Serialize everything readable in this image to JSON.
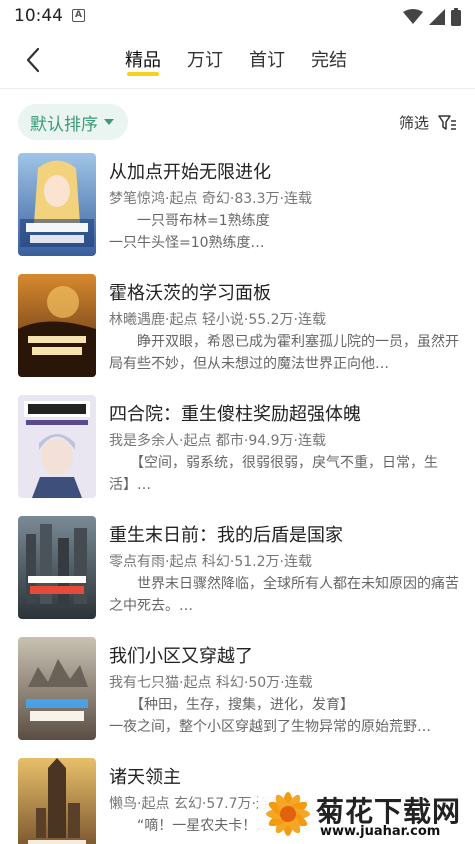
{
  "status_bar": {
    "time": "10:44",
    "indicator": "A"
  },
  "nav": {
    "back_icon": "back-arrow-icon",
    "tabs": [
      {
        "label": "精品",
        "active": true
      },
      {
        "label": "万订",
        "active": false
      },
      {
        "label": "首订",
        "active": false
      },
      {
        "label": "完结",
        "active": false
      }
    ],
    "accent_color": "#f4d21f"
  },
  "filters": {
    "sort_label": "默认排序",
    "filter_label": "筛选",
    "sort_color": "#3c9a78"
  },
  "books": [
    {
      "title": "从加点开始无限进化",
      "meta": "梦笔惊鸿·起点   奇幻·83.3万·连载",
      "desc": "　　一只哥布林=1熟练度\n一只牛头怪=10熟练度…",
      "cover_text": "从加点开始无限进化"
    },
    {
      "title": "霍格沃茨的学习面板",
      "meta": "林曦遇鹿·起点   轻小说·55.2万·连载",
      "desc": "　　睁开双眼，希恩已成为霍利塞孤儿院的一员，虽然开局有些不妙，但从未想过的魔法世界正向他…",
      "cover_text": "霍格沃茨的学习面板"
    },
    {
      "title": "四合院：重生傻柱奖励超强体魄",
      "meta": "我是多余人·起点   都市·94.9万·连载",
      "desc": "　　【空间，弱系统，很弱很弱，戾气不重，日常，生活】…",
      "cover_text": "四合院"
    },
    {
      "title": "重生末日前：我的后盾是国家",
      "meta": "零点有雨·起点   科幻·51.2万·连载",
      "desc": "　　世界末日骤然降临，全球所有人都在未知原因的痛苦之中死去。…",
      "cover_text": "重生末日前我的后盾是国家"
    },
    {
      "title": "我们小区又穿越了",
      "meta": "我有七只猫·起点   科幻·50万·连载",
      "desc": "　　【种田，生存，搜集，进化，发育】\n一夜之间，整个小区穿越到了生物异常的原始荒野…",
      "cover_text": "我们小区又穿越了"
    },
    {
      "title": "诸天领主",
      "meta": "懒鸟·起点   玄幻·57.7万·连载",
      "desc": "　　“嘀！一星农夫卡！…",
      "cover_text": "诸天领主"
    }
  ],
  "watermark": {
    "brand": "菊花下载网",
    "url": "www.juahar.com"
  }
}
